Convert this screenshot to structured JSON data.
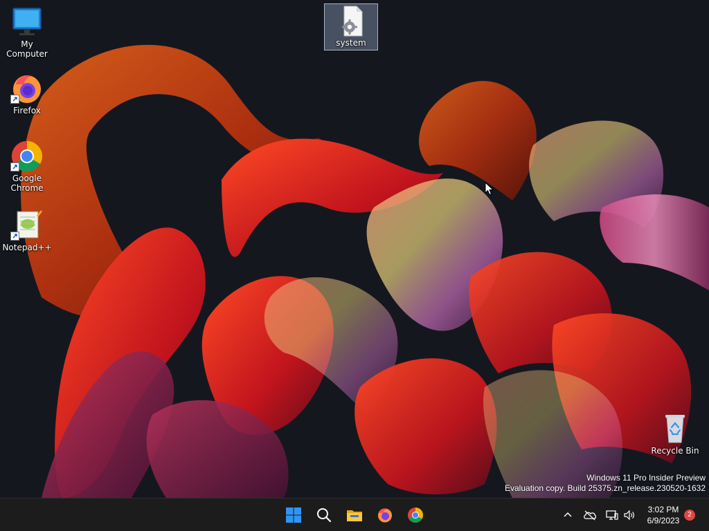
{
  "desktop": {
    "icons": [
      {
        "label": "My Computer",
        "icon": "monitor-icon"
      },
      {
        "label": "Firefox",
        "icon": "firefox-icon"
      },
      {
        "label": "Google Chrome",
        "icon": "chrome-icon"
      },
      {
        "label": "Notepad++",
        "icon": "notepadpp-icon"
      },
      {
        "label": "system",
        "icon": "settings-file-icon"
      },
      {
        "label": "Recycle Bin",
        "icon": "recycle-bin-icon"
      }
    ],
    "watermark": {
      "line1": "Windows 11 Pro Insider Preview",
      "line2": "Evaluation copy. Build 25375.zn_release.230520-1632"
    }
  },
  "taskbar": {
    "pinned": [
      {
        "name": "Start",
        "icon": "windows-logo-icon"
      },
      {
        "name": "Search",
        "icon": "search-icon"
      },
      {
        "name": "File Explorer",
        "icon": "folder-icon"
      },
      {
        "name": "Firefox",
        "icon": "firefox-icon"
      },
      {
        "name": "Google Chrome",
        "icon": "chrome-icon"
      }
    ],
    "tray": {
      "icons": [
        "chevron-up-icon",
        "onedrive-offline-icon",
        "network-icon",
        "volume-icon"
      ],
      "time": "3:02 PM",
      "date": "6/9/2023",
      "notification_count": "2"
    }
  },
  "colors": {
    "taskbar_bg": "#1c1c1c",
    "desktop_bg": "#15171f",
    "badge": "#e0463f",
    "windows_accent": "#2f95f5"
  }
}
